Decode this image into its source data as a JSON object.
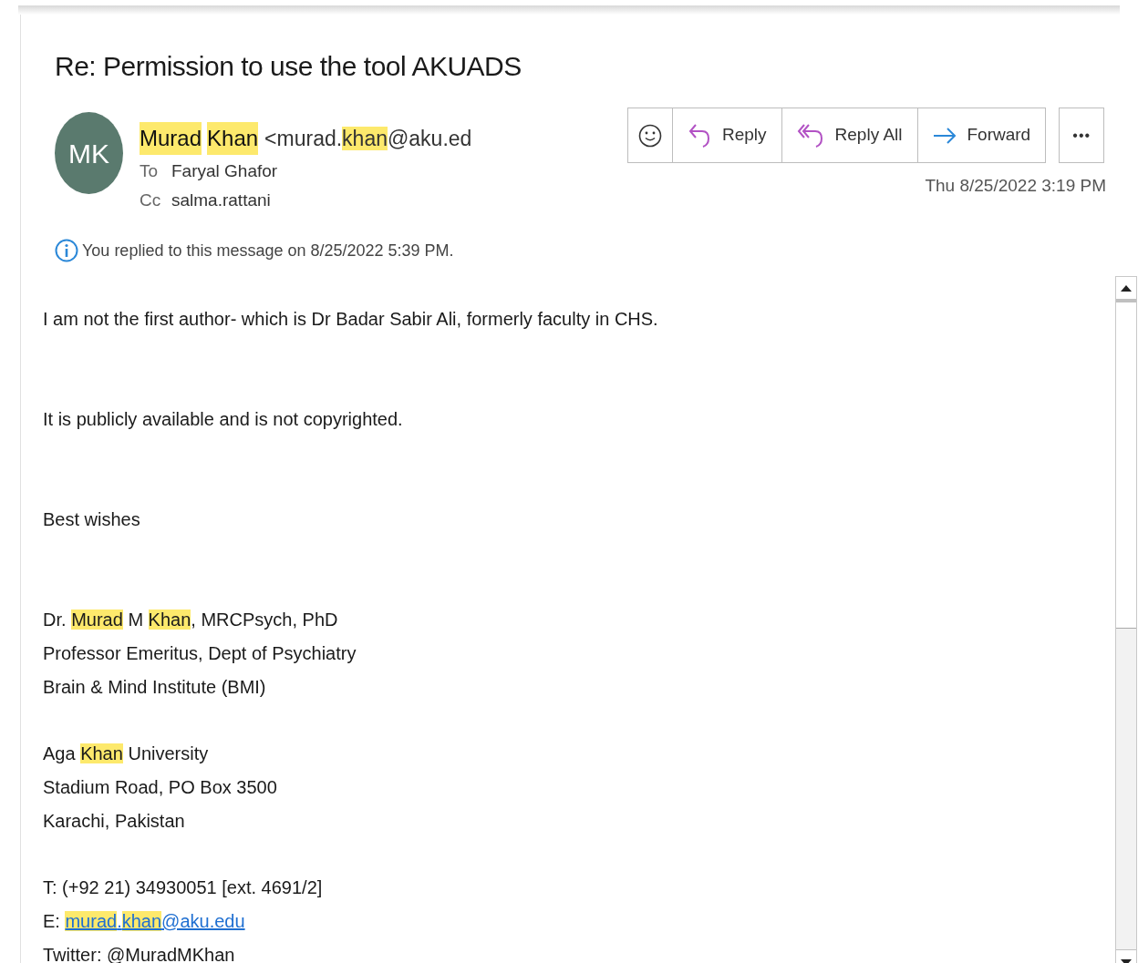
{
  "subject": "Re: Permission to use the tool AKUADS",
  "sender": {
    "initials": "MK",
    "name": [
      {
        "text": "Murad",
        "highlight": true
      },
      {
        "text": "Khan",
        "highlight": true
      }
    ],
    "address": [
      {
        "text": "<murad.",
        "highlight": false
      },
      {
        "text": "khan",
        "highlight": true
      },
      {
        "text": "@aku.ed",
        "highlight": false
      }
    ]
  },
  "recipients": [
    {
      "label": "To",
      "value": "Faryal Ghafor"
    },
    {
      "label": "Cc",
      "value": "salma.rattani"
    }
  ],
  "info": "You replied to this message on 8/25/2022 5:39 PM.",
  "actions": [
    {
      "kind": "emoji"
    },
    {
      "kind": "reply",
      "label": "Reply"
    },
    {
      "kind": "reply_all",
      "label": "Reply All"
    },
    {
      "kind": "forward",
      "label": "Forward"
    }
  ],
  "more": "•••",
  "date": "Thu 8/25/2022 3:19 PM",
  "body": [
    {
      "kind": "paragraph",
      "lines": [
        [
          {
            "text": "I am not the first author- which is Dr Badar Sabir Ali, formerly faculty in CHS."
          }
        ]
      ]
    },
    {
      "kind": "paragraph",
      "lines": [
        [
          {
            "text": "It is publicly available and is not copyrighted."
          }
        ]
      ]
    },
    {
      "kind": "paragraph",
      "lines": [
        [
          {
            "text": "Best wishes"
          }
        ]
      ]
    },
    {
      "kind": "signature",
      "lines": [
        [
          {
            "text": "Dr. "
          },
          {
            "text": "Murad",
            "highlight": true
          },
          {
            "text": " M "
          },
          {
            "text": "Khan",
            "highlight": true
          },
          {
            "text": ", MRCPsych, PhD"
          }
        ],
        [
          {
            "text": "Professor Emeritus, Dept of Psychiatry"
          }
        ],
        [
          {
            "text": "Brain & Mind Institute (BMI)"
          }
        ]
      ]
    },
    {
      "kind": "signature",
      "lines": [
        [
          {
            "text": "Aga "
          },
          {
            "text": "Khan",
            "highlight": true
          },
          {
            "text": " University"
          }
        ],
        [
          {
            "text": "Stadium Road, PO Box 3500"
          }
        ],
        [
          {
            "text": "Karachi, Pakistan"
          }
        ]
      ]
    },
    {
      "kind": "signature",
      "lines": [
        [
          {
            "text": "T: (+92 21) 34930051 [ext. 4691/2]"
          }
        ],
        [
          {
            "text": "E: "
          },
          {
            "text": "murad",
            "highlight": true,
            "link": true
          },
          {
            "text": ".",
            "link": true
          },
          {
            "text": "khan",
            "highlight": true,
            "link": true
          },
          {
            "text": "@aku.edu",
            "link": true
          }
        ],
        [
          {
            "text": "Twitter: @MuradMKhan"
          }
        ]
      ]
    }
  ]
}
